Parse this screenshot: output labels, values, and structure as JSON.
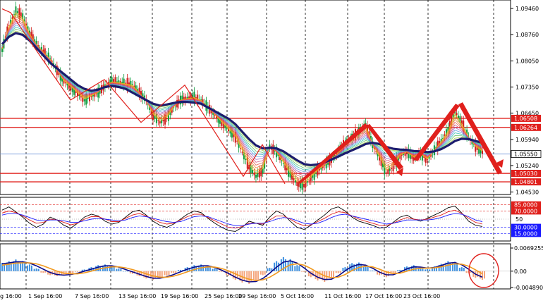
{
  "chart_data": [
    {
      "type": "line",
      "panel": "price",
      "ylim": [
        1.045,
        1.0965
      ],
      "y_ticks": [
        "1.09460",
        "1.08760",
        "1.08050",
        "1.07350",
        "1.06650",
        "1.05940",
        "1.05240",
        "1.04530"
      ],
      "x_labels": [
        "g 16:00",
        "1 Sep 16:00",
        "7 Sep 16:00",
        "13 Sep 16:00",
        "19 Sep 16:00",
        "25 Sep 16:00",
        "29 Sep 16:00",
        "5 Oct 16:00",
        "11 Oct 16:00",
        "17 Oct 16:00",
        "23 Oct 16:00"
      ],
      "horizontal_levels": [
        {
          "label": "1.06508",
          "value": 1.06508,
          "color": "#e0201c"
        },
        {
          "label": "1.06264",
          "value": 1.06264,
          "color": "#e0201c"
        },
        {
          "label": "1.05030",
          "value": 1.0503,
          "color": "#e0201c"
        },
        {
          "label": "1.04801",
          "value": 1.04801,
          "color": "#e0201c"
        }
      ],
      "current_price": {
        "label": "1.05550",
        "value": 1.0555
      },
      "series": [
        {
          "values": [
            1.0835,
            1.09,
            1.094,
            1.0925,
            1.088,
            1.085,
            1.083,
            1.081,
            1.078,
            1.075,
            1.0735,
            1.0718,
            1.07,
            1.071,
            1.072,
            1.0738,
            1.075,
            1.0748,
            1.0745,
            1.0742,
            1.072,
            1.07,
            1.066,
            1.064,
            1.065,
            1.068,
            1.07,
            1.0705,
            1.0708,
            1.07,
            1.068,
            1.066,
            1.064,
            1.062,
            1.06,
            1.056,
            1.052,
            1.0495,
            1.051,
            1.0575,
            1.056,
            1.053,
            1.05,
            1.0475,
            1.047,
            1.049,
            1.051,
            1.0525,
            1.054,
            1.056,
            1.0585,
            1.06,
            1.0615,
            1.0635,
            1.058,
            1.0545,
            1.0505,
            1.052,
            1.055,
            1.056,
            1.0545,
            1.0555,
            1.054,
            1.0565,
            1.059,
            1.062,
            1.067,
            1.064,
            1.06,
            1.0575,
            1.056
          ]
        },
        {
          "values": [
            1.085,
            1.087,
            1.088,
            1.0875,
            1.086,
            1.084,
            1.082,
            1.08,
            1.0785,
            1.077,
            1.0755,
            1.074,
            1.073,
            1.0725,
            1.0728,
            1.0735,
            1.0738,
            1.0735,
            1.073,
            1.072,
            1.071,
            1.07,
            1.069,
            1.0685,
            1.0688,
            1.0692,
            1.0695,
            1.0695,
            1.0693,
            1.069,
            1.068,
            1.067,
            1.066,
            1.065,
            1.0635,
            1.0615,
            1.0595,
            1.0578,
            1.057,
            1.0572,
            1.057,
            1.0562,
            1.055,
            1.0538,
            1.0528,
            1.0525,
            1.0527,
            1.0533,
            1.054,
            1.0548,
            1.0557,
            1.0565,
            1.0573,
            1.0582,
            1.0585,
            1.0582,
            1.0574,
            1.0569,
            1.0567,
            1.0566,
            1.0563,
            1.0562,
            1.056,
            1.0562,
            1.0568,
            1.0578,
            1.059,
            1.0596,
            1.0595,
            1.059,
            1.0585
          ],
          "color": "#1c1c6e"
        }
      ]
    },
    {
      "type": "line",
      "panel": "oscillator",
      "ylim": [
        0,
        100
      ],
      "levels": [
        {
          "label": "85.0000",
          "value": 85,
          "tag_bg": "#e0201c"
        },
        {
          "label": "70.0000",
          "value": 70,
          "tag_bg": "#e0201c"
        },
        {
          "label": "50",
          "value": 50,
          "tag_bg": ""
        },
        {
          "label": "30.0000",
          "value": 30,
          "tag_bg": "#1a1aff"
        },
        {
          "label": "15.0000",
          "value": 15,
          "tag_bg": "#1a1aff"
        }
      ],
      "series": [
        {
          "values": [
            72,
            80,
            68,
            55,
            40,
            30,
            38,
            55,
            48,
            35,
            28,
            40,
            55,
            62,
            58,
            45,
            38,
            42,
            55,
            68,
            72,
            60,
            45,
            35,
            30,
            38,
            50,
            62,
            70,
            66,
            52,
            40,
            30,
            22,
            20,
            30,
            45,
            40,
            35,
            55,
            70,
            62,
            45,
            30,
            25,
            35,
            48,
            60,
            75,
            80,
            70,
            55,
            45,
            40,
            35,
            28,
            30,
            42,
            55,
            60,
            50,
            45,
            52,
            60,
            68,
            78,
            82,
            65,
            45,
            35,
            32
          ],
          "color": "#000000"
        },
        {
          "values": [
            65,
            70,
            66,
            58,
            48,
            40,
            42,
            50,
            48,
            42,
            36,
            40,
            50,
            56,
            56,
            50,
            44,
            44,
            52,
            60,
            64,
            58,
            50,
            42,
            38,
            40,
            48,
            56,
            62,
            62,
            54,
            46,
            38,
            30,
            28,
            32,
            40,
            40,
            38,
            48,
            58,
            58,
            50,
            40,
            34,
            36,
            44,
            52,
            62,
            68,
            66,
            58,
            50,
            45,
            40,
            35,
            34,
            40,
            48,
            54,
            50,
            48,
            50,
            55,
            60,
            68,
            72,
            64,
            52,
            42,
            38
          ],
          "color": "#e0201c"
        },
        {
          "values": [
            60,
            64,
            64,
            60,
            54,
            48,
            46,
            48,
            48,
            46,
            42,
            42,
            46,
            50,
            52,
            50,
            48,
            46,
            48,
            54,
            58,
            56,
            52,
            48,
            44,
            42,
            44,
            50,
            56,
            58,
            56,
            50,
            44,
            38,
            34,
            34,
            38,
            40,
            40,
            44,
            50,
            54,
            52,
            46,
            40,
            38,
            40,
            46,
            54,
            60,
            62,
            58,
            54,
            50,
            46,
            42,
            38,
            40,
            44,
            48,
            48,
            48,
            48,
            50,
            54,
            60,
            64,
            62,
            56,
            48,
            44
          ],
          "color": "#1a1aff"
        }
      ]
    },
    {
      "type": "bar",
      "panel": "macd",
      "y_ticks": [
        "0.0069255",
        "0.00",
        "-0.0048908"
      ],
      "ylim": [
        -0.0048908,
        0.0069255
      ],
      "series": [
        {
          "values": [
            0.0025,
            0.003,
            0.0035,
            0.003,
            0.002,
            0.0008,
            -0.0005,
            -0.0012,
            -0.0015,
            -0.0012,
            -0.0008,
            -0.0002,
            0.0005,
            0.0012,
            0.0018,
            0.002,
            0.0016,
            0.0008,
            0.0,
            -0.0008,
            -0.0015,
            -0.0022,
            -0.0026,
            -0.0022,
            -0.0014,
            -0.0006,
            0.0004,
            0.0012,
            0.0018,
            0.002,
            0.0016,
            0.0008,
            -0.0002,
            -0.0014,
            -0.0026,
            -0.0034,
            -0.0038,
            -0.003,
            -0.0012,
            0.001,
            0.003,
            0.0042,
            0.0036,
            0.0018,
            -0.0002,
            -0.0018,
            -0.0028,
            -0.0032,
            -0.0022,
            -0.0006,
            0.0012,
            0.0024,
            0.0026,
            0.0016,
            0.0002,
            -0.0012,
            -0.0018,
            -0.001,
            0.0004,
            0.0014,
            0.0018,
            0.0012,
            0.0006,
            0.0014,
            0.0022,
            0.003,
            0.0028,
            0.0012,
            -0.0006,
            -0.002,
            -0.0026
          ],
          "pos_color": "#3b8fe0",
          "neg_color": "#f4a37a"
        },
        {
          "values": [
            0.0022,
            0.0025,
            0.0028,
            0.0028,
            0.0024,
            0.0016,
            0.0006,
            -0.0004,
            -0.001,
            -0.0012,
            -0.001,
            -0.0006,
            0.0,
            0.0006,
            0.0012,
            0.0016,
            0.0016,
            0.0012,
            0.0005,
            -0.0002,
            -0.0009,
            -0.0016,
            -0.0021,
            -0.0021,
            -0.0017,
            -0.001,
            -0.0002,
            0.0006,
            0.0012,
            0.0016,
            0.0016,
            0.0011,
            0.0003,
            -0.0007,
            -0.0018,
            -0.0027,
            -0.0032,
            -0.0031,
            -0.0022,
            -0.0006,
            0.0012,
            0.0027,
            0.0031,
            0.0024,
            0.001,
            -0.0006,
            -0.0018,
            -0.0025,
            -0.0024,
            -0.0014,
            0.0001,
            0.0014,
            0.002,
            0.0018,
            0.0009,
            -0.0003,
            -0.0011,
            -0.0011,
            -0.0003,
            0.0007,
            0.0013,
            0.0012,
            0.0009,
            0.0011,
            0.0017,
            0.0024,
            0.0026,
            0.0019,
            0.0006,
            -0.0009,
            -0.0018
          ],
          "color": "#0a0a8a"
        },
        {
          "values": [
            0.0018,
            0.0021,
            0.0024,
            0.0025,
            0.0025,
            0.0022,
            0.0016,
            0.0008,
            0.0,
            -0.0006,
            -0.0008,
            -0.0008,
            -0.0005,
            0.0,
            0.0006,
            0.001,
            0.0013,
            0.0013,
            0.001,
            0.0005,
            -0.0001,
            -0.0008,
            -0.0014,
            -0.0018,
            -0.0018,
            -0.0015,
            -0.0009,
            -0.0002,
            0.0005,
            0.001,
            0.0013,
            0.0012,
            0.0008,
            0.0001,
            -0.0008,
            -0.0017,
            -0.0024,
            -0.0028,
            -0.0026,
            -0.0018,
            -0.0006,
            0.0008,
            0.0019,
            0.0022,
            0.0018,
            0.0008,
            -0.0004,
            -0.0014,
            -0.002,
            -0.0018,
            -0.001,
            0.0002,
            0.0011,
            0.0015,
            0.0013,
            0.0006,
            -0.0002,
            -0.0007,
            -0.0006,
            0.0,
            0.0006,
            0.0009,
            0.0009,
            0.001,
            0.0013,
            0.0018,
            0.0022,
            0.0021,
            0.0015,
            0.0004,
            -0.0008
          ],
          "color": "#f29a1f"
        }
      ]
    }
  ]
}
